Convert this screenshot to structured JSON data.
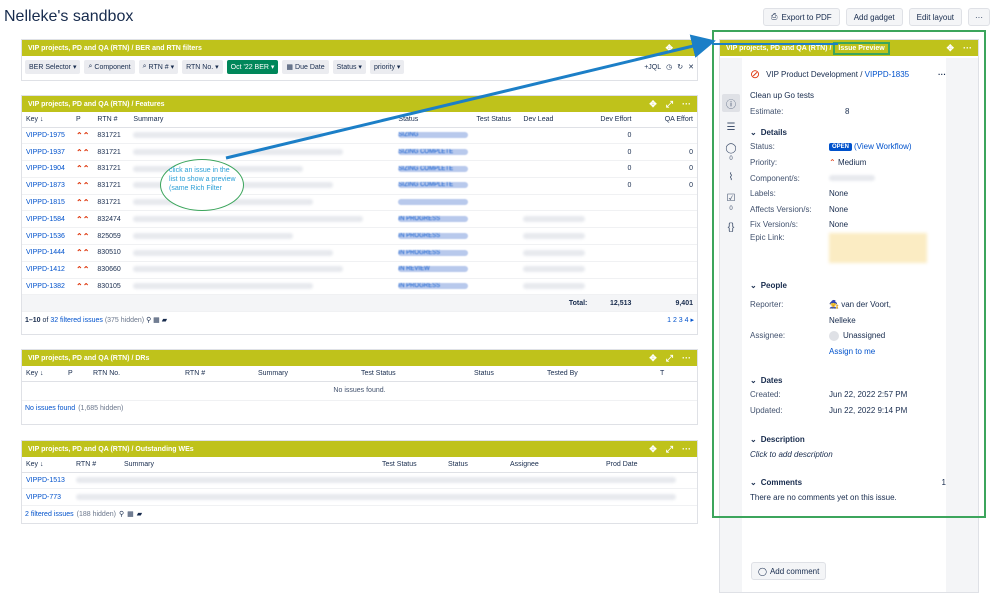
{
  "page": {
    "title": "Nelleke's sandbox"
  },
  "top_actions": {
    "export": "Export to PDF",
    "add_gadget": "Add gadget",
    "edit_layout": "Edit layout",
    "more": "···"
  },
  "filters_gadget": {
    "title": "VIP projects, PD and QA (RTN) / BER and RTN filters",
    "chips": [
      "BER Selector ▾",
      "Component",
      "RTN # ▾",
      "RTN No. ▾",
      "Oct '22 BER ▾",
      "Due Date",
      "Status ▾",
      "priority ▾"
    ],
    "jql": "+JQL"
  },
  "features_gadget": {
    "title": "VIP projects, PD and QA (RTN) / Features",
    "columns": [
      "Key ↓",
      "P",
      "RTN #",
      "Summary",
      "Status",
      "Test Status",
      "Dev Lead",
      "Dev Effort",
      "QA Effort"
    ],
    "rows": [
      {
        "key": "VIPPD-1975",
        "p": "⌃⌃",
        "rtn": "831721",
        "status": "SIZING",
        "dev": "0",
        "qa": ""
      },
      {
        "key": "VIPPD-1937",
        "p": "⌃⌃",
        "rtn": "831721",
        "status": "SIZING COMPLETE",
        "dev": "0",
        "qa": "0"
      },
      {
        "key": "VIPPD-1904",
        "p": "⌃⌃",
        "rtn": "831721",
        "status": "SIZING COMPLETE",
        "dev": "0",
        "qa": "0"
      },
      {
        "key": "VIPPD-1873",
        "p": "⌃⌃",
        "rtn": "831721",
        "status": "SIZING COMPLETE",
        "dev": "0",
        "qa": "0"
      },
      {
        "key": "VIPPD-1815",
        "p": "⌃⌃",
        "rtn": "831721",
        "status": "",
        "dev": "",
        "qa": ""
      },
      {
        "key": "VIPPD-1584",
        "p": "⌃⌃",
        "rtn": "832474",
        "status": "IN PROGRESS",
        "dev": "",
        "qa": ""
      },
      {
        "key": "VIPPD-1536",
        "p": "⌃⌃",
        "rtn": "825059",
        "status": "IN PROGRESS",
        "dev": "",
        "qa": ""
      },
      {
        "key": "VIPPD-1444",
        "p": "⌃⌃",
        "rtn": "830510",
        "status": "IN PROGRESS",
        "dev": "",
        "qa": ""
      },
      {
        "key": "VIPPD-1412",
        "p": "⌃⌃",
        "rtn": "830660",
        "status": "IN REVIEW",
        "dev": "",
        "qa": ""
      },
      {
        "key": "VIPPD-1382",
        "p": "⌃⌃",
        "rtn": "830105",
        "status": "IN PROGRESS",
        "dev": "",
        "qa": ""
      }
    ],
    "total_label": "Total:",
    "total_dev": "12,513",
    "total_qa": "9,401",
    "footer_range": "1–10",
    "footer_of": "of",
    "footer_count": "32 filtered issues",
    "footer_hidden": "(375 hidden)",
    "pages": "1 2 3 4 ▸"
  },
  "callout": {
    "text": "click an issue in the list to show a preview (same Rich Filter"
  },
  "drs_gadget": {
    "title": "VIP projects, PD and QA (RTN) / DRs",
    "columns": [
      "Key ↓",
      "P",
      "RTN No.",
      "RTN #",
      "Summary",
      "Test Status",
      "Status",
      "Tested By",
      "T"
    ],
    "empty": "No issues found.",
    "footer": "No issues found",
    "footer_hidden": "(1,685 hidden)"
  },
  "wes_gadget": {
    "title": "VIP projects, PD and QA (RTN) / Outstanding WEs",
    "columns": [
      "Key ↓",
      "RTN #",
      "Summary",
      "Test Status",
      "Status",
      "Assignee",
      "Prod Date"
    ],
    "rows": [
      {
        "key": "VIPPD-1513"
      },
      {
        "key": "VIPPD-773"
      }
    ],
    "footer": "2 filtered issues",
    "footer_hidden": "(188 hidden)"
  },
  "preview": {
    "title": "VIP projects, PD and QA (RTN) /",
    "tag": "Issue Preview",
    "project": "VIP Product Development",
    "issue_key": "VIPPD-1835",
    "summary": "Clean up Go tests",
    "estimate_label": "Estimate:",
    "estimate": "8",
    "details_label": "Details",
    "status_label": "Status:",
    "status": "OPEN",
    "workflow_link": "(View Workflow)",
    "priority_label": "Priority:",
    "priority": "Medium",
    "component_label": "Component/s:",
    "labels_label": "Labels:",
    "labels": "None",
    "affects_label": "Affects Version/s:",
    "affects": "None",
    "fix_label": "Fix Version/s:",
    "fix": "None",
    "epic_label": "Epic Link:",
    "people_label": "People",
    "reporter_label": "Reporter:",
    "reporter": "van der Voort,",
    "reporter2": "Nelleke",
    "assignee_label": "Assignee:",
    "assignee": "Unassigned",
    "assign_me": "Assign to me",
    "dates_label": "Dates",
    "created_label": "Created:",
    "created": "Jun 22, 2022 2:57 PM",
    "updated_label": "Updated:",
    "updated": "Jun 22, 2022 9:14 PM",
    "description_label": "Description",
    "description_placeholder": "Click to add description",
    "comments_label": "Comments",
    "comments_count": "1",
    "no_comments": "There are no comments yet on this issue.",
    "add_comment": "Add comment",
    "rail_counts": [
      "0",
      "0"
    ]
  }
}
